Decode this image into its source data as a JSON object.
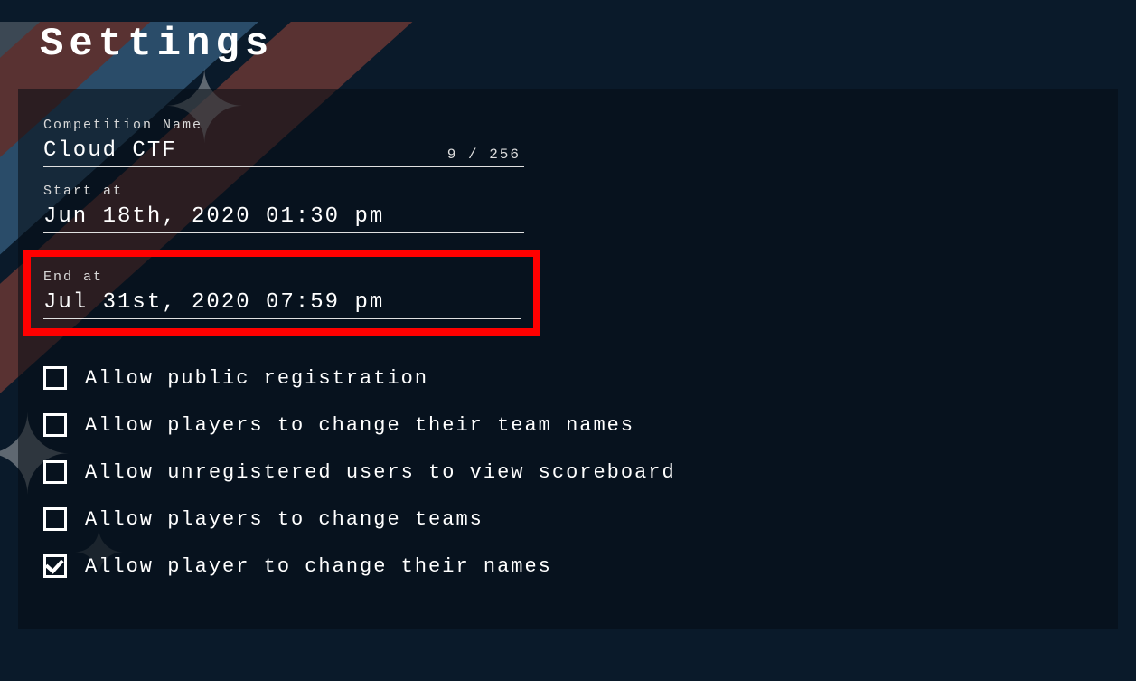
{
  "page_title": "Settings",
  "fields": {
    "competition_name": {
      "label": "Competition Name",
      "value": "Cloud CTF",
      "counter": "9 / 256"
    },
    "start_at": {
      "label": "Start at",
      "value": "Jun 18th, 2020 01:30 pm"
    },
    "end_at": {
      "label": "End at",
      "value": "Jul 31st, 2020 07:59 pm"
    }
  },
  "checkboxes": {
    "public_registration": {
      "label": "Allow public registration",
      "checked": false
    },
    "change_team_names": {
      "label": "Allow players to change their team names",
      "checked": false
    },
    "unregistered_scoreboard": {
      "label": "Allow unregistered users to view scoreboard",
      "checked": false
    },
    "change_teams": {
      "label": "Allow players to change teams",
      "checked": false
    },
    "change_names": {
      "label": "Allow player to change their names",
      "checked": true
    }
  }
}
